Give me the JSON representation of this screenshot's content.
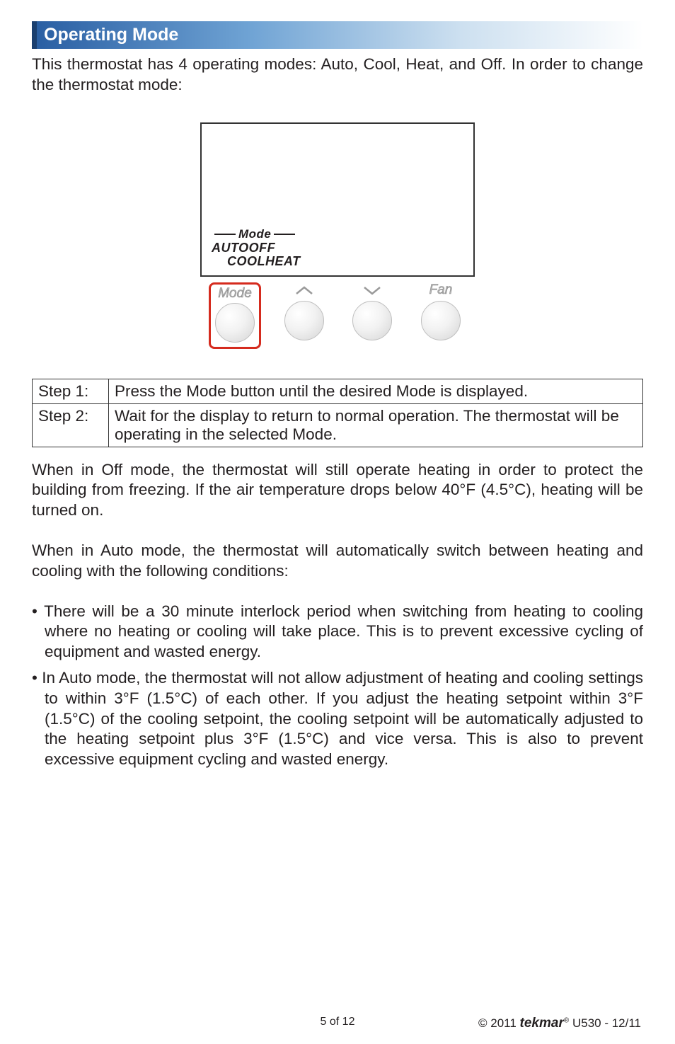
{
  "header": "Operating Mode",
  "intro": "This thermostat has 4 operating modes: Auto, Cool, Heat, and Off. In order to change the thermostat mode:",
  "lcd": {
    "mode_word": "Mode",
    "row2": "AUTOOFF",
    "row3": "COOLHEAT"
  },
  "buttons": {
    "mode": "Mode",
    "fan": "Fan"
  },
  "steps": [
    {
      "label": "Step 1:",
      "text": "Press the Mode button until the desired Mode is displayed."
    },
    {
      "label": "Step 2:",
      "text": "Wait for the display to return to normal operation. The thermostat will be operating in the selected Mode."
    }
  ],
  "para1": "When in Off mode, the thermostat will still operate heating in order to protect the building from freezing. If the air temperature drops below 40°F (4.5°C), heating will be turned on.",
  "para2": "When in Auto mode, the thermostat will automatically switch between heating and cooling with the following conditions:",
  "bullets": [
    "There will be a 30 minute interlock period when switching from heating to cooling where no heating or cooling will take place. This is to prevent excessive cycling of equipment and wasted energy.",
    "In Auto mode, the thermostat will not allow adjustment of heating and cooling settings to within 3°F (1.5°C) of each other. If you adjust the heating setpoint within 3°F (1.5°C) of the cooling setpoint, the cooling setpoint will be automatically adjusted to the heating setpoint plus 3°F (1.5°C) and vice versa. This is also to prevent excessive equipment cycling and wasted energy."
  ],
  "footer": {
    "page": "5 of 12",
    "copyright": "© 2011",
    "brand": "tekmar",
    "reg": "®",
    "doc": " U530 - 12/11"
  }
}
